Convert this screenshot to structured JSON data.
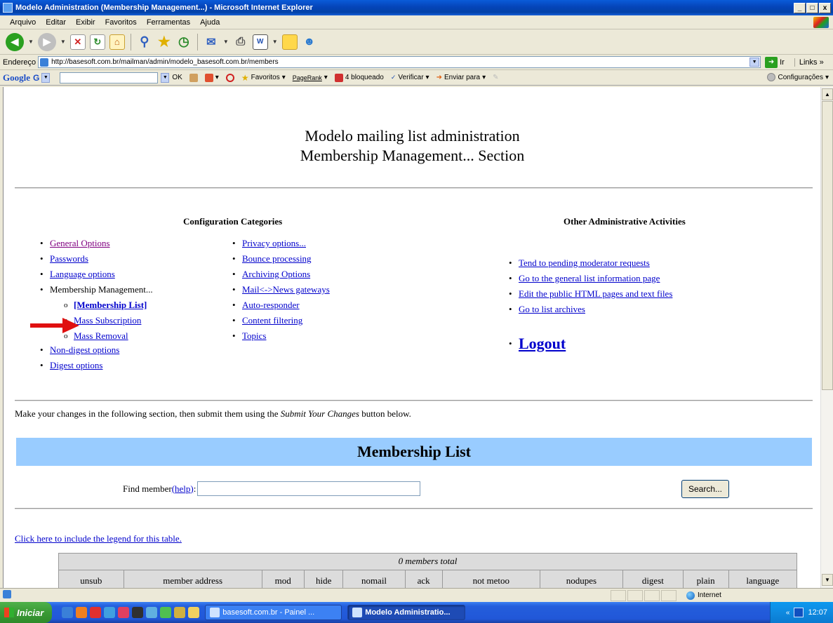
{
  "window": {
    "title": "Modelo Administration (Membership Management...) - Microsoft Internet Explorer",
    "buttons": [
      "_",
      "□",
      "x"
    ]
  },
  "menu": [
    "Arquivo",
    "Editar",
    "Exibir",
    "Favoritos",
    "Ferramentas",
    "Ajuda"
  ],
  "address": {
    "label": "Endereço",
    "url": "http://basesoft.com.br/mailman/admin/modelo_basesoft.com.br/members",
    "go_label": "Ir",
    "links_label": "Links »"
  },
  "google_toolbar": {
    "logo": "Google",
    "g_label": "G",
    "ok_label": "OK",
    "favoritos_label": "Favoritos",
    "pagerank_label": "PageRank",
    "blocked_label": "4 bloqueado",
    "verificar_label": "Verificar",
    "enviar_label": "Enviar para",
    "config_label": "Configurações"
  },
  "page": {
    "heading_line1": "Modelo mailing list administration",
    "heading_line2": "Membership Management... Section",
    "config_heading": "Configuration Categories",
    "other_heading": "Other Administrative Activities",
    "config_col1": [
      "General Options",
      "Passwords",
      "Language options"
    ],
    "membership_mgmt_label": "Membership Management...",
    "membership_sub": [
      "[Membership List]",
      "Mass Subscription",
      "Mass Removal"
    ],
    "config_col1_after": [
      "Non-digest options",
      "Digest options"
    ],
    "config_col2": [
      "Privacy options...",
      "Bounce processing",
      "Archiving Options",
      "Mail<->News gateways",
      "Auto-responder",
      "Content filtering",
      "Topics"
    ],
    "other_links": [
      "Tend to pending moderator requests",
      "Go to the general list information page",
      "Edit the public HTML pages and text files",
      "Go to list archives"
    ],
    "logout_label": "Logout",
    "instructions_before": "Make your changes in the following section, then submit them using the ",
    "instructions_em": "Submit Your Changes",
    "instructions_after": " button below.",
    "section_title": "Membership List",
    "find_label": "Find member ",
    "find_help": "(help)",
    "find_colon": ":",
    "find_value": "",
    "search_label": "Search...",
    "legend_link": "Click here to include the legend for this table.",
    "members_total": "0 members total",
    "table_headers": [
      "unsub",
      "member address\nmember name",
      "mod",
      "hide",
      "nomail\n[reason]",
      "ack",
      "not metoo",
      "nodupes",
      "digest",
      "plain",
      "language"
    ]
  },
  "status": {
    "zone_label": "Internet"
  },
  "taskbar": {
    "start_label": "Iniciar",
    "tasks": [
      "basesoft.com.br - Painel ...",
      "Modelo Administratio..."
    ],
    "clock": "12:07",
    "tray_chevron": "«"
  },
  "colors": {
    "section_bar": "#99ccff",
    "link": "#0000cc",
    "visited_link": "#800080",
    "arrow": "#e01010"
  }
}
